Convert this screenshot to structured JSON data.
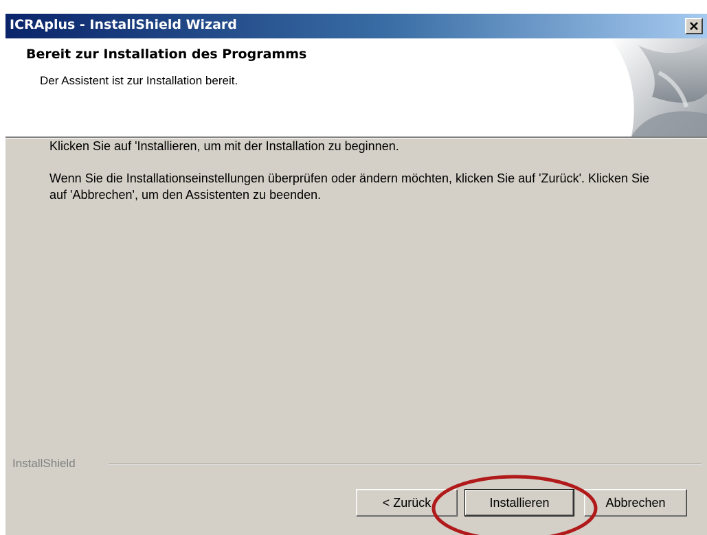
{
  "window": {
    "title": "ICRAplus - InstallShield Wizard",
    "close_glyph": "×"
  },
  "header": {
    "title": "Bereit zur Installation des Programms",
    "subtitle": "Der Assistent ist zur Installation bereit."
  },
  "body": {
    "paragraph1": "Klicken Sie auf 'Installieren, um mit der Installation zu beginnen.",
    "paragraph2": "Wenn Sie die Installationseinstellungen überprüfen oder ändern möchten, klicken Sie auf 'Zurück'. Klicken Sie auf 'Abbrechen', um den Assistenten zu beenden."
  },
  "footer": {
    "brand": "InstallShield",
    "back_label": "< Zurück",
    "install_label": "Installieren",
    "cancel_label": "Abbrechen"
  },
  "colors": {
    "title_gradient_start": "#0a246a",
    "title_gradient_end": "#a6caf0",
    "dialog_face": "#d4d0c8",
    "highlight_ring": "#b11a1a"
  },
  "icons": {
    "close": "close-icon",
    "header_art": "installshield-header-graphic"
  }
}
